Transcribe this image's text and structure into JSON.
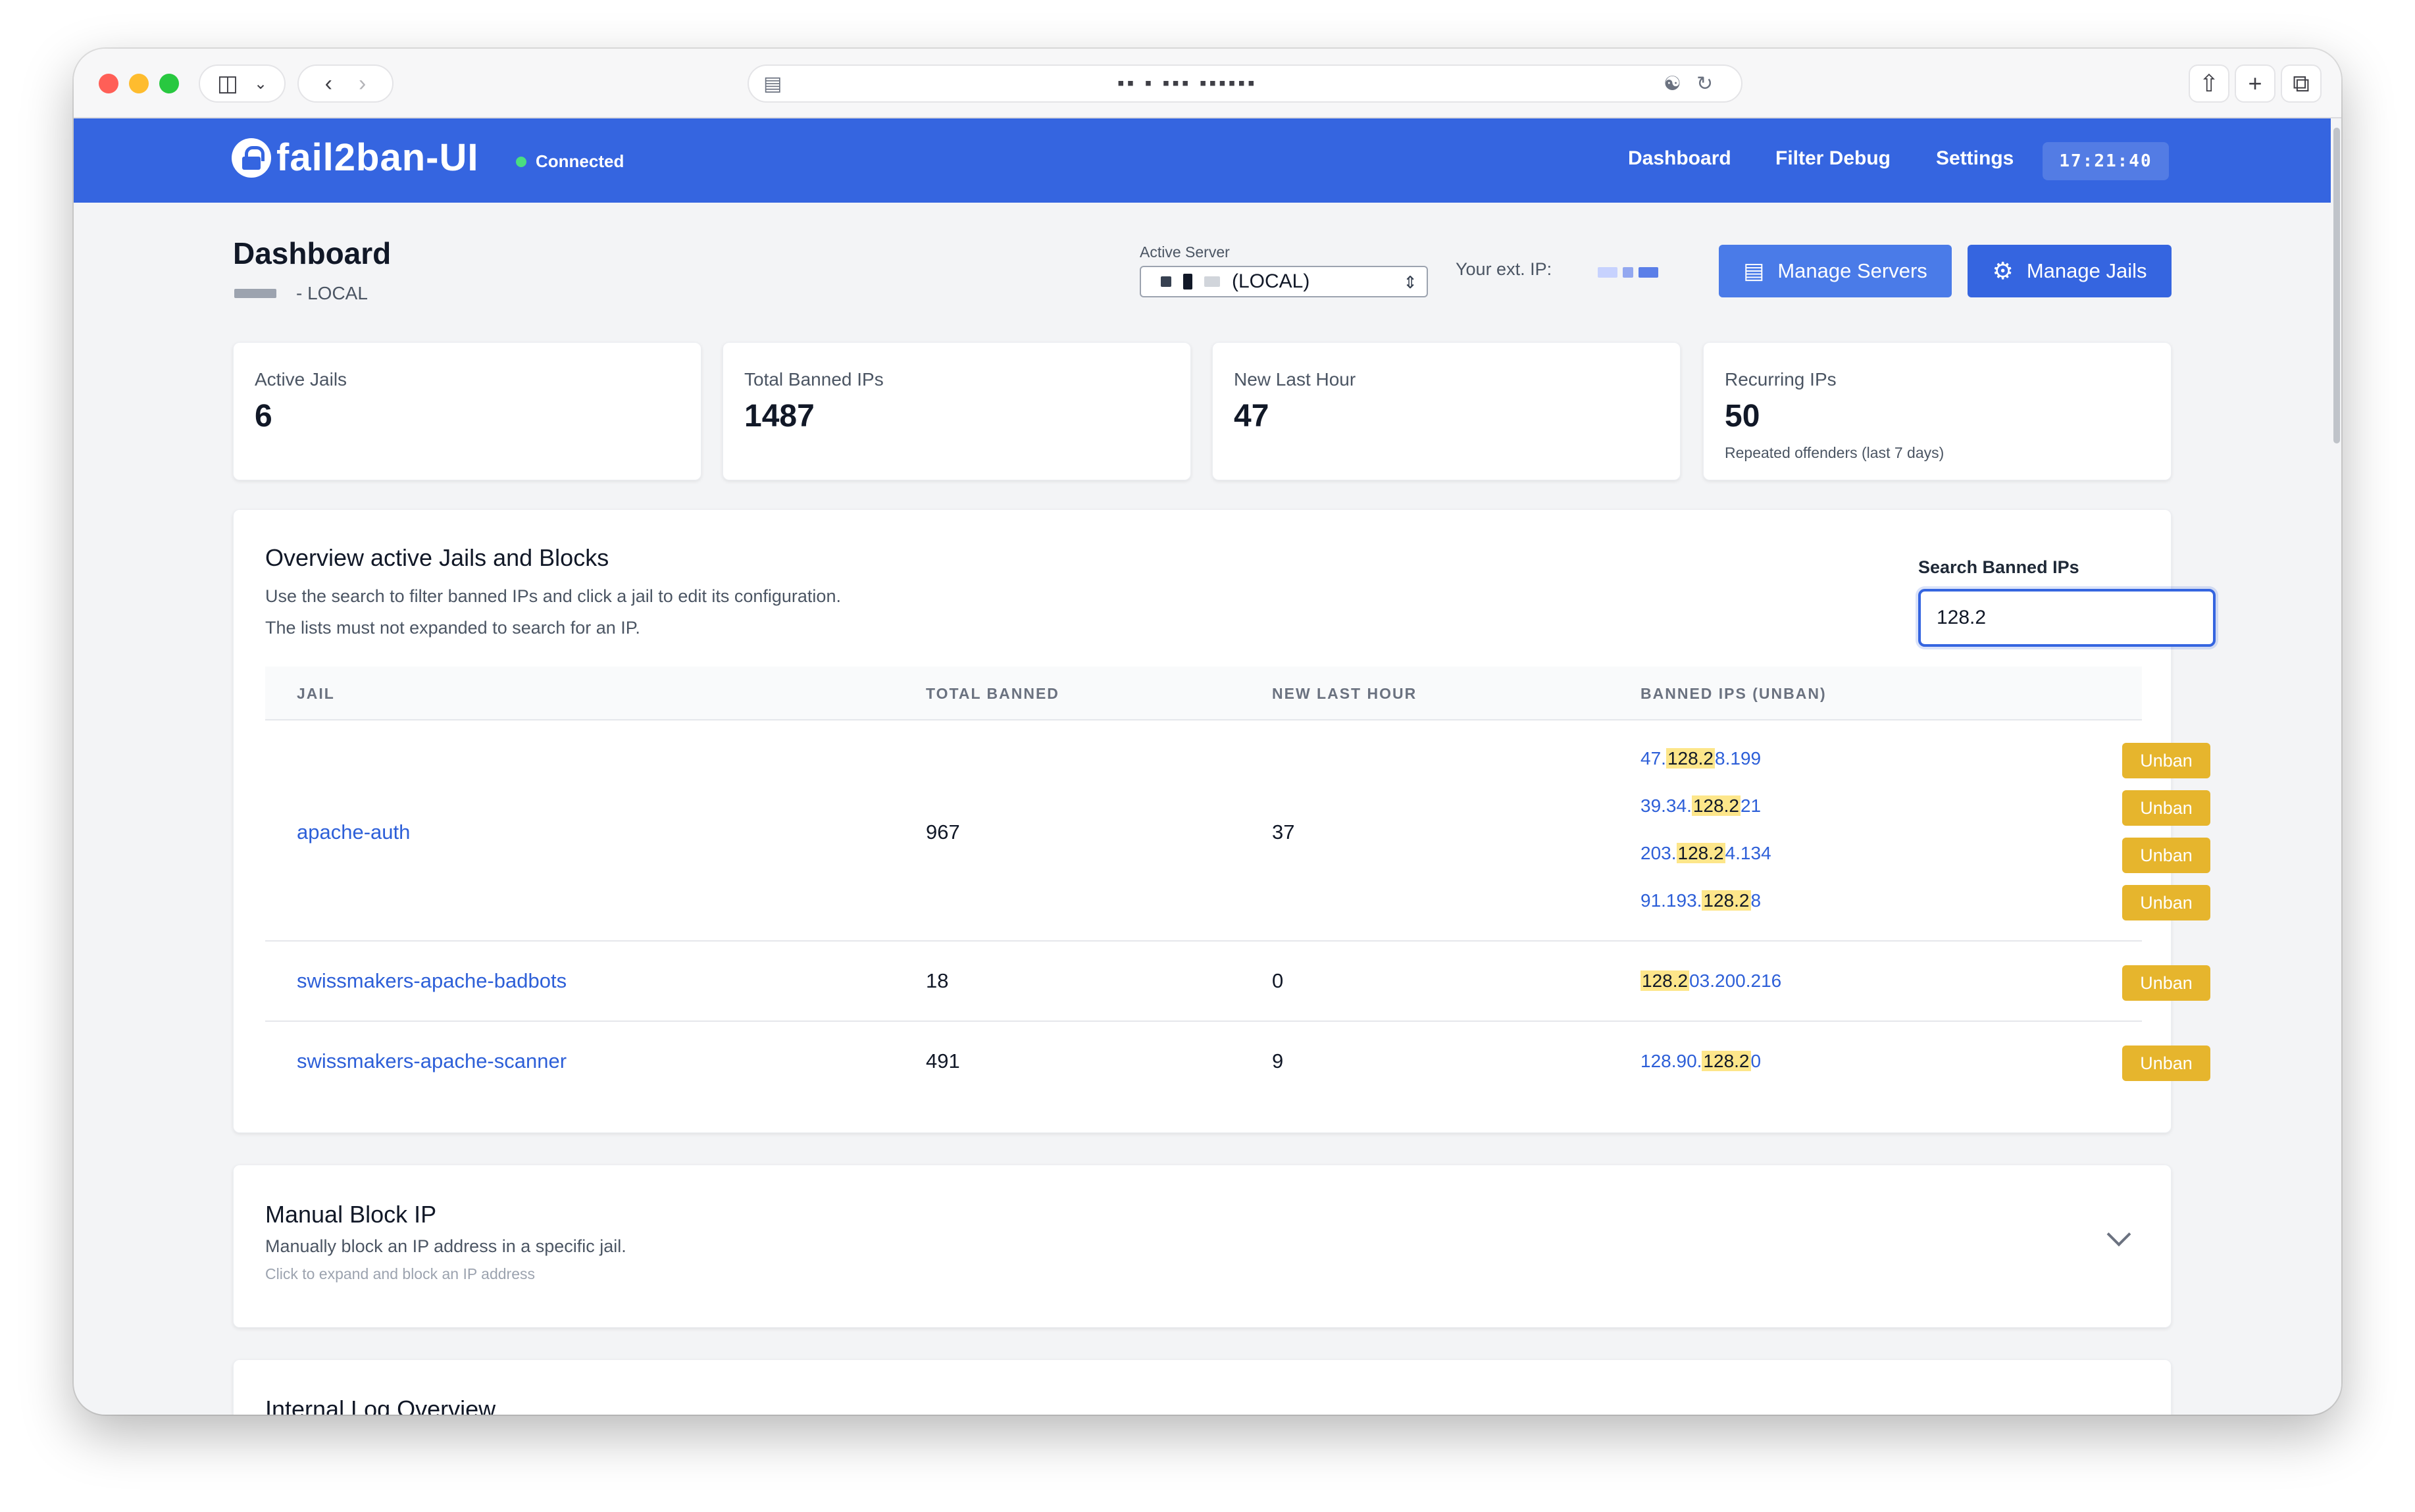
{
  "browser": {
    "url": "▪▪  ▪   ▪▪▪   ▪▪▪▪▪▪"
  },
  "navbar": {
    "brand": "fail2ban-UI",
    "status": "Connected",
    "links": [
      "Dashboard",
      "Filter Debug",
      "Settings"
    ],
    "clock": "17:21:40"
  },
  "header": {
    "title": "Dashboard",
    "subtitle": "- LOCAL",
    "server_label": "Active Server",
    "server_value": "(LOCAL)",
    "ext_ip_label": "Your ext. IP:",
    "manage_servers": "Manage Servers",
    "manage_jails": "Manage Jails"
  },
  "stats": [
    {
      "label": "Active Jails",
      "value": "6",
      "note": ""
    },
    {
      "label": "Total Banned IPs",
      "value": "1487",
      "note": ""
    },
    {
      "label": "New Last Hour",
      "value": "47",
      "note": ""
    },
    {
      "label": "Recurring IPs",
      "value": "50",
      "note": "Repeated offenders (last 7 days)"
    }
  ],
  "overview": {
    "title": "Overview active Jails and Blocks",
    "desc1": "Use the search to filter banned IPs and click a jail to edit its configuration.",
    "desc2": "The lists must not expanded to search for an IP.",
    "search_label": "Search Banned IPs",
    "search_value": "128.2",
    "columns": [
      "JAIL",
      "TOTAL BANNED",
      "NEW LAST HOUR",
      "BANNED IPS (UNBAN)"
    ],
    "unban_label": "Unban",
    "rows": [
      {
        "jail": "apache-auth",
        "total": "967",
        "new": "37",
        "ips": [
          {
            "pre": "47.",
            "match": "128.2",
            "post": "8.199"
          },
          {
            "pre": "39.34.",
            "match": "128.2",
            "post": "21"
          },
          {
            "pre": "203.",
            "match": "128.2",
            "post": "4.134"
          },
          {
            "pre": "91.193.",
            "match": "128.2",
            "post": "8"
          }
        ]
      },
      {
        "jail": "swissmakers-apache-badbots",
        "total": "18",
        "new": "0",
        "ips": [
          {
            "pre": "",
            "match": "128.2",
            "post": "03.200.216"
          }
        ]
      },
      {
        "jail": "swissmakers-apache-scanner",
        "total": "491",
        "new": "9",
        "ips": [
          {
            "pre": "128.90.",
            "match": "128.2",
            "post": "0"
          }
        ]
      }
    ]
  },
  "manual_block": {
    "title": "Manual Block IP",
    "desc": "Manually block an IP address in a specific jail.",
    "hint": "Click to expand and block an IP address"
  },
  "log_overview": {
    "title": "Internal Log Overview"
  },
  "colors": {
    "primary": "#3565e0",
    "unban": "#e6b52d",
    "highlight": "#fde68a",
    "connected": "#4ade80"
  }
}
